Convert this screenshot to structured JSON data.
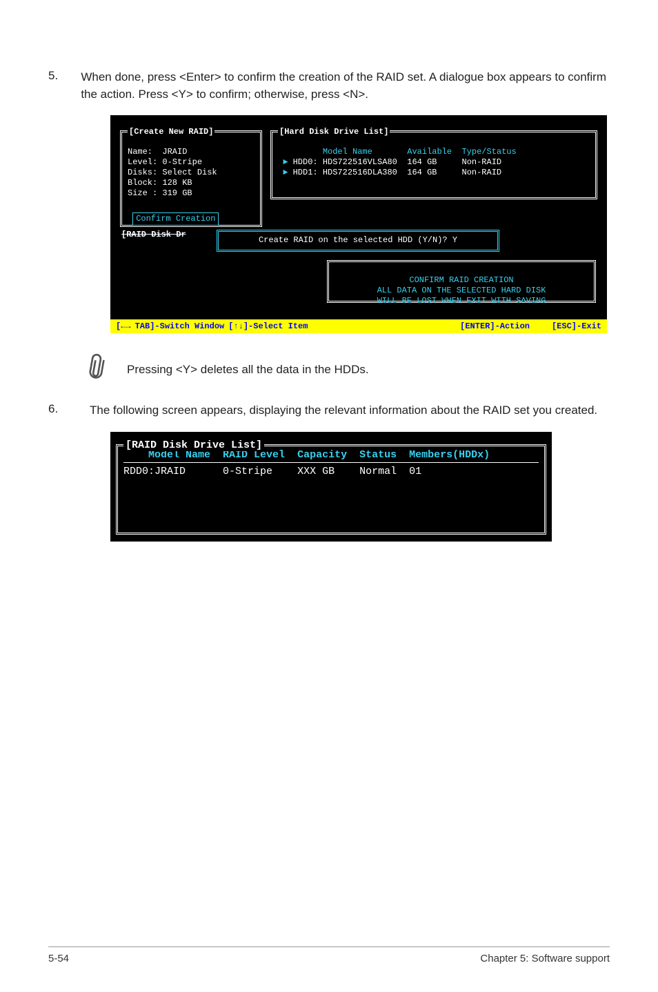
{
  "step5": {
    "num": "5.",
    "text": "When done, press <Enter> to confirm the creation of the RAID set. A dialogue box appears to confirm the action. Press <Y> to confirm; otherwise, press <N>."
  },
  "bios1": {
    "createPanel": {
      "title": "[Create New RAID]",
      "l1": "Name:  JRAID",
      "l2": "Level: 0-Stripe",
      "l3": "Disks: Select Disk",
      "l4": "Block: 128 KB",
      "l5": "Size : 319 GB",
      "confirm": "Confirm Creation"
    },
    "drivePanel": {
      "title": "[Hard Disk Drive List]",
      "hdr_model": "Model Name",
      "hdr_avail": "Available",
      "hdr_type": "Type/Status",
      "r1_dev": "HDD0:",
      "r1_model": "HDS722516VLSA80",
      "r1_avail": "164 GB",
      "r1_type": "Non-RAID",
      "r2_dev": "HDD1:",
      "r2_model": "HDS722516DLA380",
      "r2_avail": "164 GB",
      "r2_type": "Non-RAID"
    },
    "diskPanelTitle": "[RAID Disk Dr",
    "confirmDlg": "Create RAID on the selected HDD (Y/N)? Y",
    "warn": {
      "l1": "CONFIRM RAID CREATION",
      "l2": "ALL DATA ON THE SELECTED HARD DISK",
      "l3": "WILL BE LOST WHEN EXIT WITH SAVING"
    },
    "hints": {
      "tab": "TAB]-Switch Window",
      "updown": "[↑↓]-Select Item",
      "enter": "[ENTER]-Action",
      "esc": "[ESC]-Exit"
    }
  },
  "note": "Pressing <Y> deletes all the data in the HDDs.",
  "step6": {
    "num": "6.",
    "text": "The following screen appears, displaying the relevant information about the RAID set you created."
  },
  "bios2": {
    "title": "[RAID Disk Drive List]",
    "hdr_model": "Model Name",
    "hdr_level": "RAID Level",
    "hdr_cap": "Capacity",
    "hdr_stat": "Status",
    "hdr_mem": "Members(HDDx)",
    "r_model": "RDD0:JRAID",
    "r_level": "0-Stripe",
    "r_cap": "XXX GB",
    "r_stat": "Normal",
    "r_mem": "01"
  },
  "footer": {
    "left": "5-54",
    "right": "Chapter 5: Software support"
  }
}
